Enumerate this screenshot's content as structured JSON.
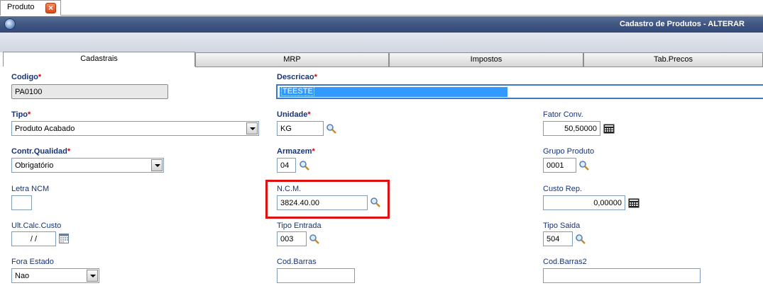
{
  "doc_tab": {
    "label": "Produto"
  },
  "window": {
    "title": "Cadastro de Produtos - ALTERAR"
  },
  "section_tabs": [
    {
      "label": "Cadastrais",
      "active": true
    },
    {
      "label": "MRP",
      "active": false
    },
    {
      "label": "Impostos",
      "active": false
    },
    {
      "label": "Tab.Precos",
      "active": false
    }
  ],
  "form": {
    "codigo": {
      "label": "Codigo",
      "value": "PA0100"
    },
    "descricao": {
      "label": "Descricao",
      "value": "TEESTE"
    },
    "tipo": {
      "label": "Tipo",
      "value": "Produto Acabado"
    },
    "unidade": {
      "label": "Unidade",
      "value": "KG"
    },
    "fator_conv": {
      "label": "Fator Conv.",
      "value": "50,50000"
    },
    "contr_qualidade": {
      "label": "Contr.Qualidad",
      "value": "Obrigatório"
    },
    "armazem": {
      "label": "Armazem",
      "value": "04"
    },
    "grupo_produto": {
      "label": "Grupo Produto",
      "value": "0001"
    },
    "letra_ncm": {
      "label": "Letra NCM",
      "value": ""
    },
    "ncm": {
      "label": "N.C.M.",
      "value": "3824.40.00"
    },
    "custo_rep": {
      "label": "Custo Rep.",
      "value": "0,00000"
    },
    "ult_calc_custo": {
      "label": "Ult.Calc.Custo",
      "value": "/ /"
    },
    "tipo_entrada": {
      "label": "Tipo Entrada",
      "value": "003"
    },
    "tipo_saida": {
      "label": "Tipo Saida",
      "value": "504"
    },
    "fora_estado": {
      "label": "Fora Estado",
      "value": "Nao"
    },
    "cod_barras": {
      "label": "Cod.Barras",
      "value": ""
    },
    "cod_barras2": {
      "label": "Cod.Barras2",
      "value": ""
    }
  },
  "required_marker": "*",
  "colors": {
    "accent": "#e01010",
    "label": "#16347a",
    "selection": "#3399ff"
  }
}
